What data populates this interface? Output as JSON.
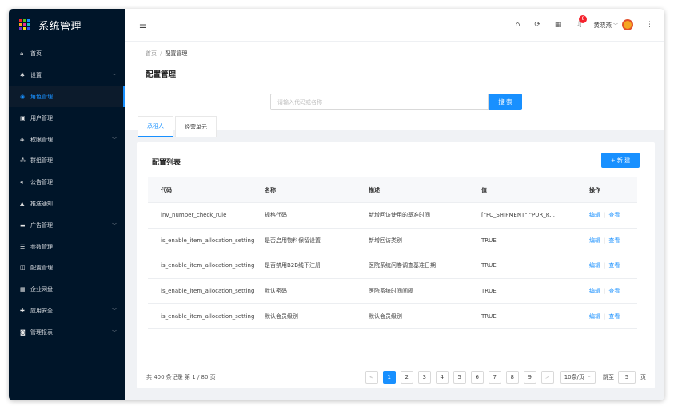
{
  "sidebar": {
    "brand_title": "系统管理",
    "logo_colors": [
      "#f5222d",
      "#52c41a",
      "#1890ff",
      "#faad14",
      "#eb2f96",
      "#13c2c2",
      "#722ed1",
      "#fadb14",
      "#2f54eb"
    ],
    "items": [
      {
        "label": "首页",
        "icon": "home-icon",
        "glyph": "⌂",
        "arrow": ""
      },
      {
        "label": "设置",
        "icon": "gear-icon",
        "glyph": "✱",
        "arrow": "﹀"
      },
      {
        "label": "角色管理",
        "icon": "role-icon",
        "glyph": "◉",
        "arrow": ""
      },
      {
        "label": "用户管理",
        "icon": "user-icon",
        "glyph": "▣",
        "arrow": ""
      },
      {
        "label": "权限管理",
        "icon": "shield-icon",
        "glyph": "◈",
        "arrow": "﹀"
      },
      {
        "label": "群组管理",
        "icon": "group-icon",
        "glyph": "⁂",
        "arrow": ""
      },
      {
        "label": "公告管理",
        "icon": "speaker-icon",
        "glyph": "◂",
        "arrow": ""
      },
      {
        "label": "推送通知",
        "icon": "bell-icon",
        "glyph": "▲",
        "arrow": ""
      },
      {
        "label": "广告管理",
        "icon": "ad-icon",
        "glyph": "▬",
        "arrow": "﹀"
      },
      {
        "label": "参数管理",
        "icon": "params-icon",
        "glyph": "☰",
        "arrow": ""
      },
      {
        "label": "配置管理",
        "icon": "config-icon",
        "glyph": "◫",
        "arrow": ""
      },
      {
        "label": "企业网盘",
        "icon": "disk-icon",
        "glyph": "▦",
        "arrow": ""
      },
      {
        "label": "应用安全",
        "icon": "security-icon",
        "glyph": "✚",
        "arrow": "﹀"
      },
      {
        "label": "管理报表",
        "icon": "report-icon",
        "glyph": "◙",
        "arrow": "﹀"
      }
    ],
    "active_index": 2
  },
  "header": {
    "menu_glyph": "☰",
    "home_glyph": "⌂",
    "refresh_glyph": "⟳",
    "apps_glyph": "▦",
    "bell_glyph": "♫",
    "notification_count": "8",
    "user_name": "黄晓燕",
    "user_caret": "﹀",
    "more_glyph": "⋮"
  },
  "page": {
    "breadcrumb_home": "首页",
    "breadcrumb_sep": "/",
    "breadcrumb_current": "配置管理",
    "title": "配置管理",
    "search_placeholder": "请输入代码或名称",
    "search_button": "搜 索",
    "tabs": [
      "承租人",
      "经营单元"
    ],
    "active_tab": 0
  },
  "table": {
    "title": "配置列表",
    "new_button": "+ 新 建",
    "columns": [
      "代码",
      "名称",
      "描述",
      "值",
      "操作"
    ],
    "rows": [
      [
        "inv_number_check_rule",
        "规格代码",
        "新增回访使用的基准时间",
        "[\"FC_SHIPMENT\",\"PUR_R..."
      ],
      [
        "is_enable_item_allocation_setting",
        "是否启用物料保留设置",
        "新增回访类别",
        "TRUE"
      ],
      [
        "is_enable_item_allocation_setting",
        "是否禁用B2B线下注册",
        "医院系统问卷调查基准日期",
        "TRUE"
      ],
      [
        "is_enable_item_allocation_setting",
        "默认密码",
        "医院系统时间间隔",
        "TRUE"
      ],
      [
        "is_enable_item_allocation_setting",
        "默认会员级别",
        "默认会员级别",
        "TRUE"
      ]
    ],
    "action_edit": "编辑",
    "action_sep": "|",
    "action_view": "查看"
  },
  "pagination": {
    "summary": "共 400 条记录 第 1 / 80 页",
    "prev": "<",
    "next": ">",
    "pages": [
      "1",
      "2",
      "3",
      "4",
      "5",
      "6",
      "7",
      "8",
      "9"
    ],
    "current": "1",
    "page_size": "10条/页",
    "page_size_caret": "﹀",
    "jump_label": "跳至",
    "jump_value": "5",
    "page_label": "页"
  },
  "colors": {
    "accent": "#1890ff",
    "sidebar_bg": "#001529",
    "badge": "#f5222d"
  }
}
